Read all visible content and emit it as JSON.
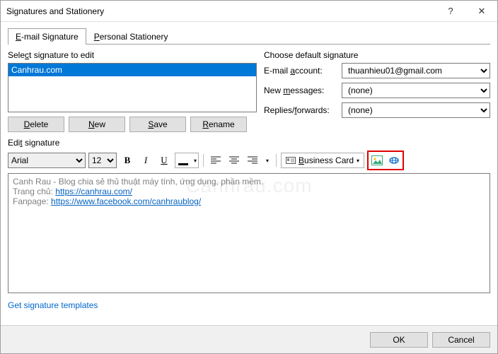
{
  "window": {
    "title": "Signatures and Stationery",
    "help": "?",
    "close": "✕"
  },
  "tabs": {
    "email": "E-mail Signature",
    "stationery": "Personal Stationery",
    "email_ul": "E",
    "stationery_ul": "P"
  },
  "select_label": "Select signature to edit",
  "select_label_ul": "c",
  "siglist": {
    "items": [
      "Canhrau.com"
    ]
  },
  "buttons": {
    "delete": "Delete",
    "new": "New",
    "save": "Save",
    "rename": "Rename"
  },
  "default_group": {
    "title": "Choose default signature",
    "account_label": "E-mail account:",
    "account_value": "thuanhieu01@gmail.com",
    "newmsg_label": "New messages:",
    "newmsg_value": "(none)",
    "replies_label": "Replies/forwards:",
    "replies_value": "(none)"
  },
  "edit_label": "Edit signature",
  "toolbar": {
    "font": "Arial",
    "size": "12",
    "bold": "B",
    "italic": "I",
    "underline": "U",
    "bizcard": "Business Card"
  },
  "editor": {
    "line1": "Canh Rau - Blog chia sẻ thủ thuật máy tính, ứng dụng, phần mềm.",
    "line2_prefix": "Trang chủ: ",
    "line2_link": "https://canhrau.com/",
    "line3_prefix": "Fanpage: ",
    "line3_link": "https://www.facebook.com/canhraublog/"
  },
  "get_templates": "Get signature templates",
  "footer": {
    "ok": "OK",
    "cancel": "Cancel"
  }
}
